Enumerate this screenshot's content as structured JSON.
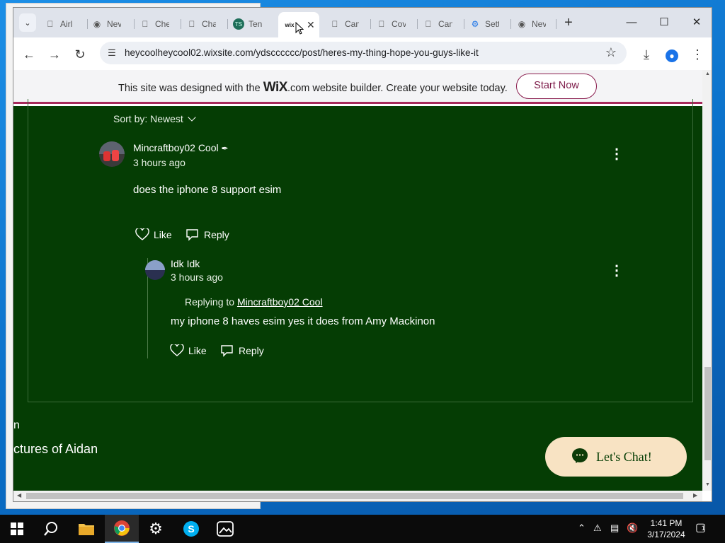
{
  "browser": {
    "tabs": [
      {
        "title": "Airl",
        "icon": "apple-icon"
      },
      {
        "title": "Nev",
        "icon": "chrome-icon"
      },
      {
        "title": "Che",
        "icon": "apple-icon"
      },
      {
        "title": "Cha",
        "icon": "apple-icon"
      },
      {
        "title": "Ten",
        "icon": "ts-icon"
      },
      {
        "title": "wix",
        "icon": "wix-icon",
        "active": true
      },
      {
        "title": "Can",
        "icon": "apple-icon"
      },
      {
        "title": "Cov",
        "icon": "apple-icon"
      },
      {
        "title": "Can",
        "icon": "apple-icon"
      },
      {
        "title": "Sett",
        "icon": "gear-icon"
      },
      {
        "title": "Nev",
        "icon": "chrome-icon"
      }
    ],
    "url": "heycoolheycool02.wixsite.com/ydscccccc/post/heres-my-thing-hope-you-guys-like-it"
  },
  "wix_banner": {
    "message_prefix": "This site was designed with the",
    "logo": "WiX",
    "logo_suffix": ".com",
    "message_suffix": "website builder. Create your website today.",
    "cta": "Start Now"
  },
  "comments": {
    "sort_label": "Sort by: Newest",
    "comment": {
      "author": "Mincraftboy02 Cool",
      "time": "3 hours ago",
      "body": "does the iphone 8 support esim",
      "like": "Like",
      "reply": "Reply"
    },
    "reply": {
      "author": "Idk Idk",
      "time": "3 hours ago",
      "replying_to_label": "Replying to",
      "replying_to_user": "Mincraftboy02 Cool",
      "body": "my iphone 8 haves esim yes it does from Amy Mackinon",
      "like": "Like",
      "reply": "Reply"
    }
  },
  "footer": {
    "line1": "n",
    "line2": "ctures of Aidan"
  },
  "chat": {
    "label": "Let's Chat!"
  },
  "taskbar": {
    "time": "1:41 PM",
    "date": "3/17/2024",
    "notification_count": "1"
  },
  "colors": {
    "page_bg": "#053d04",
    "banner_accent": "#a8295c",
    "chat_bg": "#f8e3c3"
  }
}
